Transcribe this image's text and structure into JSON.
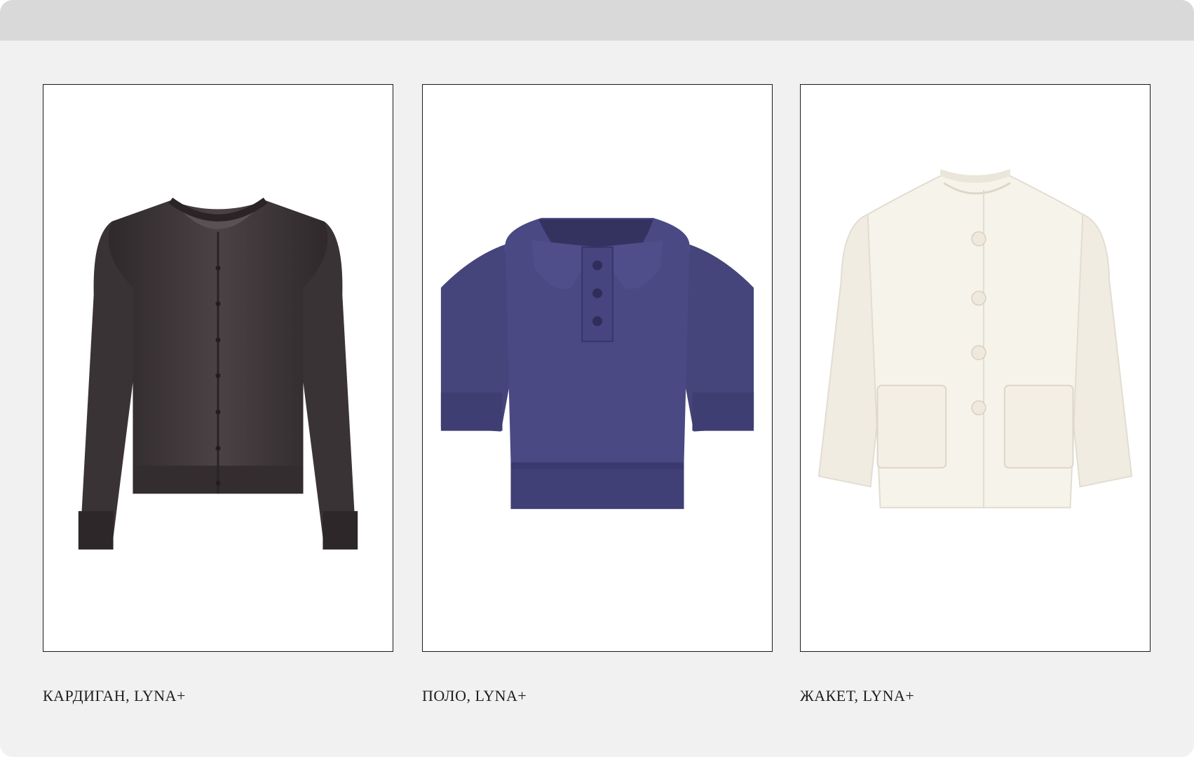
{
  "products": [
    {
      "caption": "КАРДИГАН, LYNA+",
      "image_icon": "cardigan-icon",
      "color": "#3e3638"
    },
    {
      "caption": "ПОЛО, LYNA+",
      "image_icon": "polo-icon",
      "color": "#48477f"
    },
    {
      "caption": "ЖАКЕТ, LYNA+",
      "image_icon": "jacket-icon",
      "color": "#f4f1e8"
    }
  ],
  "colors": {
    "page_background": "#f1f1f1",
    "top_bar": "#d9d9d9",
    "card_border": "#1a1a1a",
    "caption_text": "#1e1e1e"
  }
}
